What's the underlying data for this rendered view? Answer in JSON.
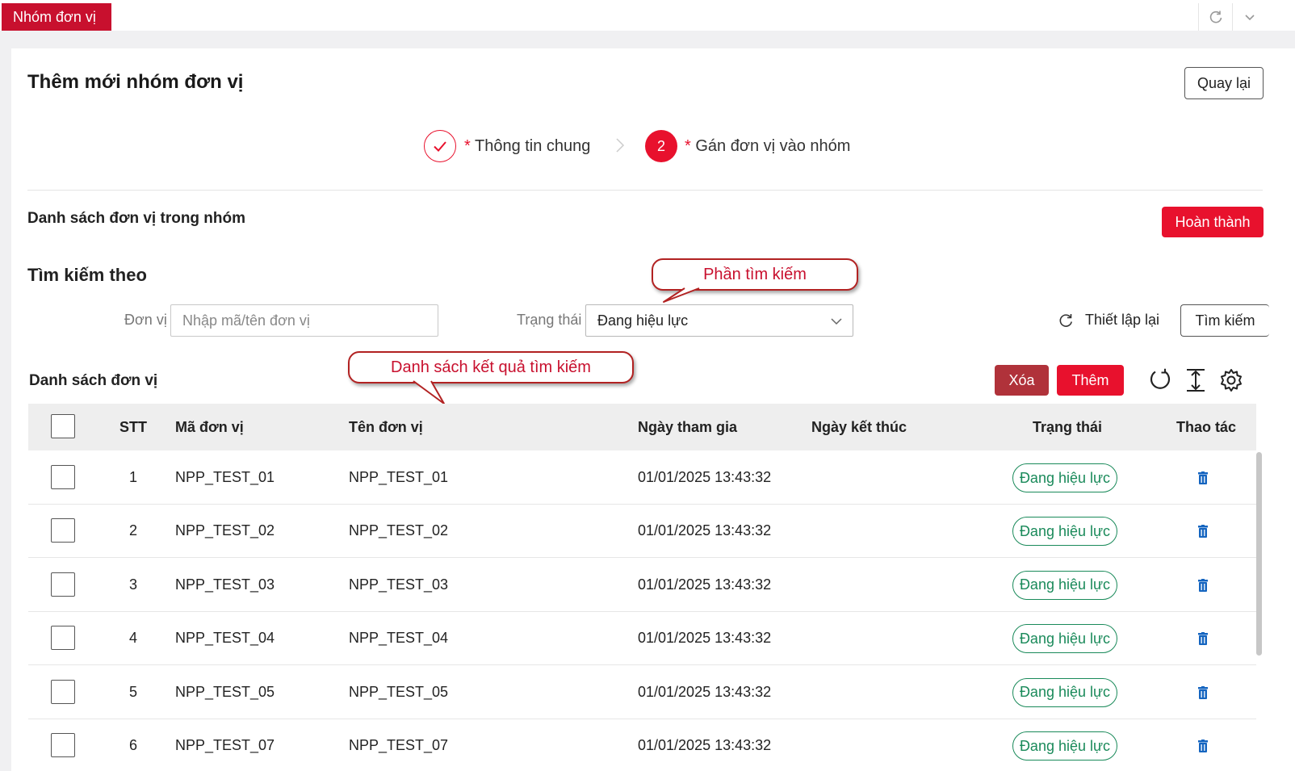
{
  "topbar": {
    "tab_label": "Nhóm đơn vị"
  },
  "page": {
    "title": "Thêm mới nhóm đơn vị",
    "back_label": "Quay lại"
  },
  "steps": [
    {
      "label": "Thông tin chung",
      "state": "done"
    },
    {
      "number": "2",
      "label": "Gán đơn vị vào nhóm",
      "state": "active"
    }
  ],
  "group_section": {
    "title": "Danh sách đơn vị trong nhóm",
    "finish_label": "Hoàn thành"
  },
  "search": {
    "title": "Tìm kiếm theo",
    "unit_label": "Đơn vị",
    "unit_placeholder": "Nhập mã/tên đơn vị",
    "status_label": "Trạng thái",
    "status_value": "Đang hiệu lực",
    "reset_label": "Thiết lập lại",
    "search_label": "Tìm kiếm"
  },
  "callouts": {
    "search_area": "Phần tìm kiếm",
    "results_list": "Danh sách kết quả tìm kiếm"
  },
  "list": {
    "title": "Danh sách đơn vị",
    "delete_label": "Xóa",
    "add_label": "Thêm",
    "columns": [
      "STT",
      "Mã đơn vị",
      "Tên đơn vị",
      "Ngày tham gia",
      "Ngày kết thúc",
      "Trạng thái",
      "Thao tác"
    ],
    "rows": [
      {
        "stt": "1",
        "code": "NPP_TEST_01",
        "name": "NPP_TEST_01",
        "join_date": "01/01/2025 13:43:32",
        "end_date": "",
        "status": "Đang hiệu lực"
      },
      {
        "stt": "2",
        "code": "NPP_TEST_02",
        "name": "NPP_TEST_02",
        "join_date": "01/01/2025 13:43:32",
        "end_date": "",
        "status": "Đang hiệu lực"
      },
      {
        "stt": "3",
        "code": "NPP_TEST_03",
        "name": "NPP_TEST_03",
        "join_date": "01/01/2025 13:43:32",
        "end_date": "",
        "status": "Đang hiệu lực"
      },
      {
        "stt": "4",
        "code": "NPP_TEST_04",
        "name": "NPP_TEST_04",
        "join_date": "01/01/2025 13:43:32",
        "end_date": "",
        "status": "Đang hiệu lực"
      },
      {
        "stt": "5",
        "code": "NPP_TEST_05",
        "name": "NPP_TEST_05",
        "join_date": "01/01/2025 13:43:32",
        "end_date": "",
        "status": "Đang hiệu lực"
      },
      {
        "stt": "6",
        "code": "NPP_TEST_07",
        "name": "NPP_TEST_07",
        "join_date": "01/01/2025 13:43:32",
        "end_date": "",
        "status": "Đang hiệu lực"
      }
    ]
  },
  "icons": {
    "refresh": "refresh-icon",
    "chevron": "chevron-down-icon",
    "check": "check-icon",
    "step_arrow": "chevron-right-icon",
    "reload": "reload-icon",
    "row_height": "row-height-icon",
    "settings": "gear-icon",
    "trash": "trash-icon"
  },
  "colors": {
    "brand_red": "#e8112d",
    "tab_red": "#c8102e",
    "delete_dark_red": "#b0323a",
    "status_green": "#1a8a5a",
    "action_blue": "#1565c0"
  }
}
